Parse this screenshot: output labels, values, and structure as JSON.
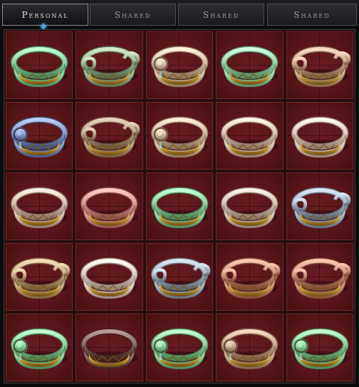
{
  "tabs": [
    {
      "label": "Personal",
      "active": true
    },
    {
      "label": "Shared",
      "active": false
    },
    {
      "label": "Shared",
      "active": false
    },
    {
      "label": "Shared",
      "active": false
    }
  ],
  "inventory": {
    "items": [
      {
        "icon": "ring-icon",
        "style": "band",
        "color": "#8fcfa4"
      },
      {
        "icon": "ring-icon",
        "style": "coil",
        "color": "#9fb898"
      },
      {
        "icon": "ring-icon",
        "style": "gem",
        "color": "#d8c0a8"
      },
      {
        "icon": "ring-icon",
        "style": "band",
        "color": "#9fd6ad"
      },
      {
        "icon": "ring-icon",
        "style": "coil",
        "color": "#c9a990"
      },
      {
        "icon": "ring-icon",
        "style": "gem",
        "color": "#8a9cc6"
      },
      {
        "icon": "ring-icon",
        "style": "coil",
        "color": "#b8a088"
      },
      {
        "icon": "ring-icon",
        "style": "gem",
        "color": "#d6bca4"
      },
      {
        "icon": "ring-icon",
        "style": "band",
        "color": "#dcc4b4"
      },
      {
        "icon": "ring-icon",
        "style": "band",
        "color": "#dfc8bc"
      },
      {
        "icon": "ring-icon",
        "style": "band",
        "color": "#d8bfb2"
      },
      {
        "icon": "ring-icon",
        "style": "band",
        "color": "#d89a94"
      },
      {
        "icon": "ring-icon",
        "style": "band",
        "color": "#92d2a4"
      },
      {
        "icon": "ring-icon",
        "style": "band",
        "color": "#d6c2b6"
      },
      {
        "icon": "ring-icon",
        "style": "coil",
        "color": "#a6b4c4"
      },
      {
        "icon": "ring-icon",
        "style": "coil",
        "color": "#c4aa86"
      },
      {
        "icon": "ring-icon",
        "style": "band",
        "color": "#e0ccc4"
      },
      {
        "icon": "ring-icon",
        "style": "coil",
        "color": "#a8b6c0"
      },
      {
        "icon": "ring-icon",
        "style": "coil",
        "color": "#c9957e"
      },
      {
        "icon": "ring-icon",
        "style": "coil",
        "color": "#c9957e"
      },
      {
        "icon": "ring-icon",
        "style": "gem",
        "color": "#92cf9f"
      },
      {
        "icon": "ring-icon",
        "style": "band",
        "color": "#8a6a64"
      },
      {
        "icon": "ring-icon",
        "style": "gem",
        "color": "#92cf9f"
      },
      {
        "icon": "ring-icon",
        "style": "gem",
        "color": "#c9a890"
      },
      {
        "icon": "ring-icon",
        "style": "gem",
        "color": "#92cf9f"
      }
    ]
  },
  "colors": {
    "gold": "#c99a2e",
    "gold_light": "#f0d36a",
    "slot_bg": "#5a161a"
  }
}
